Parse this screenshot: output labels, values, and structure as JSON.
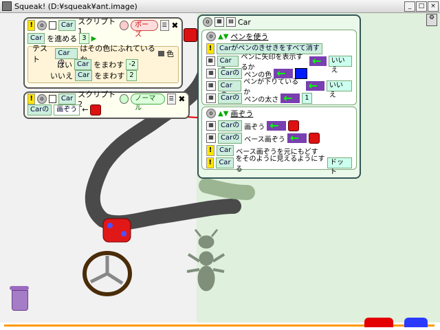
{
  "window": {
    "title": "Squeak! (D:¥squeak¥ant.image)"
  },
  "script1": {
    "name": "スクリプト1",
    "status": "ポーズ",
    "player": "Car",
    "forward": {
      "player": "Car",
      "label": "を進める",
      "value": "3"
    },
    "test": {
      "label": "テスト",
      "player": "Carの",
      "condition": "はその色にふれているか",
      "color_label": "色",
      "yes_label": "はい",
      "yes_stmt": {
        "player": "Car",
        "label": "をまわす",
        "value": "-2"
      },
      "no_label": "いいえ",
      "no_stmt": {
        "player": "Car",
        "label": "をまわす",
        "value": "2"
      }
    }
  },
  "script2": {
    "name": "スクリプト2",
    "status": "ノーマル",
    "player": "Car",
    "stmt": {
      "player": "Carの",
      "label": "画ぞう",
      "assign": "←"
    }
  },
  "viewer": {
    "title": "Car",
    "pen": {
      "header": "ペンを使う",
      "rows": [
        {
          "text": "Carがペンのきせきをすべて消す"
        },
        {
          "player": "Carの",
          "text": "ペンに矢印を表示するか",
          "value": "いいえ"
        },
        {
          "player": "Carの",
          "text": "ペンの色"
        },
        {
          "player": "Carの",
          "text": "ペンが下りているか",
          "value": "いいえ"
        },
        {
          "player": "Carの",
          "text": "ペンの太さ",
          "value": "1"
        }
      ]
    },
    "picture": {
      "header": "画ぞう",
      "rows": [
        {
          "player": "Carの",
          "text": "画ぞう"
        },
        {
          "player": "Carの",
          "text": "ベース画ぞう"
        },
        {
          "player": "Car",
          "text": "ベース画ぞうを元にもどす"
        },
        {
          "player": "Car",
          "text": "をそのように見えるようにする",
          "extra": "ドット"
        }
      ]
    }
  },
  "colors": {
    "track": "#4a4a4a",
    "right_bg": "#dff0dc",
    "arrow": "#e00000"
  }
}
